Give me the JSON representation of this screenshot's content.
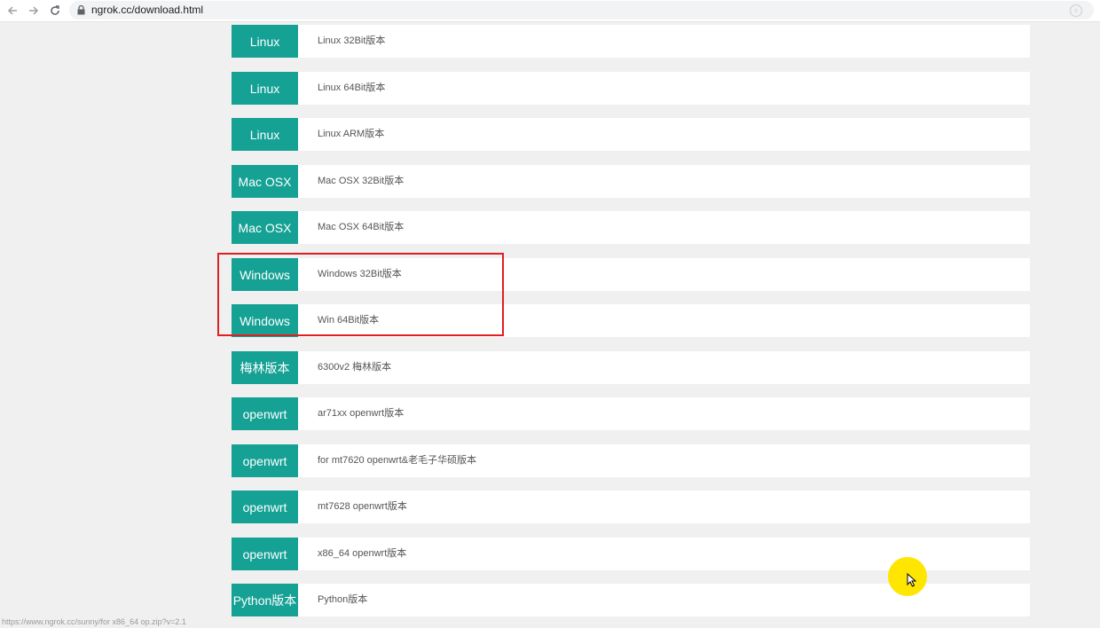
{
  "browser": {
    "url": "ngrok.cc/download.html",
    "back_icon": "arrow-left-icon",
    "forward_icon": "arrow-right-icon",
    "reload_icon": "reload-icon",
    "lock_icon": "lock-icon"
  },
  "downloads": [
    {
      "label": "Linux",
      "desc": "Linux 32Bit版本"
    },
    {
      "label": "Linux",
      "desc": "Linux 64Bit版本"
    },
    {
      "label": "Linux",
      "desc": "Linux ARM版本"
    },
    {
      "label": "Mac OSX",
      "desc": "Mac OSX 32Bit版本"
    },
    {
      "label": "Mac OSX",
      "desc": "Mac OSX 64Bit版本"
    },
    {
      "label": "Windows",
      "desc": "Windows 32Bit版本"
    },
    {
      "label": "Windows",
      "desc": "Win 64Bit版本"
    },
    {
      "label": "梅林版本",
      "desc": "6300v2 梅林版本"
    },
    {
      "label": "openwrt",
      "desc": "ar71xx openwrt版本"
    },
    {
      "label": "openwrt",
      "desc": "for mt7620 openwrt&老毛子华硕版本"
    },
    {
      "label": "openwrt",
      "desc": "mt7628 openwrt版本"
    },
    {
      "label": "openwrt",
      "desc": "x86_64 openwrt版本"
    },
    {
      "label": "Python版本",
      "desc": "Python版本"
    }
  ],
  "status_bar": {
    "hover_url": "https://www.ngrok.cc/sunny/for x86_64 op.zip?v=2.1"
  },
  "colors": {
    "accent": "#16a195",
    "highlight": "#e02020",
    "background": "#f0f0f0"
  }
}
